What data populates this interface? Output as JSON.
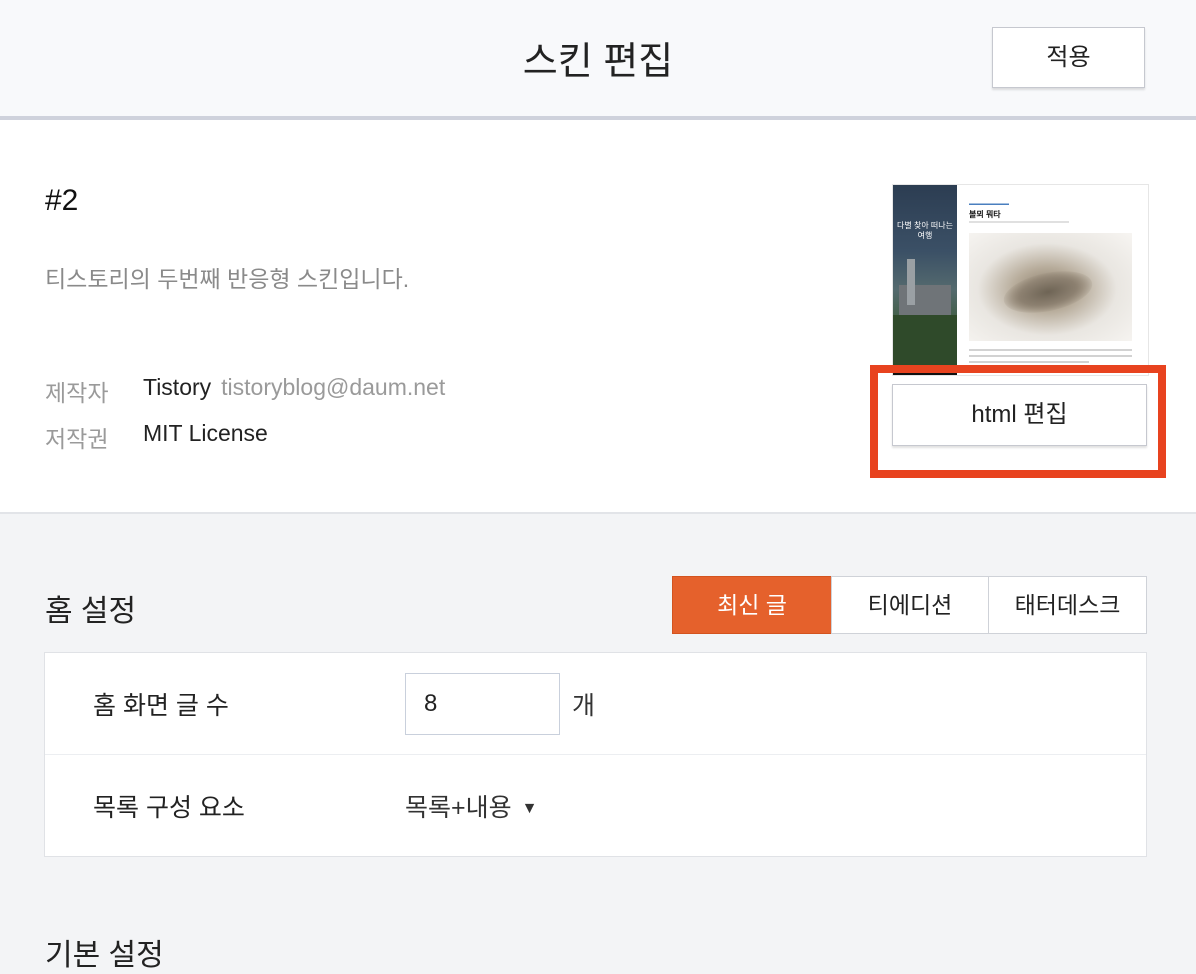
{
  "header": {
    "title": "스킨 편집",
    "apply_label": "적용"
  },
  "skin": {
    "name": "#2",
    "description": "티스토리의 두번째 반응형 스킨입니다.",
    "maker_label": "제작자",
    "maker_name": "Tistory",
    "maker_email": "tistoryblog@daum.net",
    "license_label": "저작권",
    "license_value": "MIT License",
    "html_edit_label": "html 편집",
    "preview": {
      "sidebar_text": "다별 찾아 떠나는 여행",
      "post_title": "볼뫼 뭐타"
    }
  },
  "home_settings": {
    "title": "홈 설정",
    "tabs": [
      {
        "label": "최신 글",
        "active": true
      },
      {
        "label": "티에디션",
        "active": false
      },
      {
        "label": "태터데스크",
        "active": false
      }
    ],
    "post_count_label": "홈 화면 글 수",
    "post_count_value": "8",
    "post_count_unit": "개",
    "list_components_label": "목록 구성 요소",
    "list_components_value": "목록+내용"
  },
  "next_section": {
    "title": "기본 설정"
  },
  "colors": {
    "accent": "#e5612c",
    "highlight": "#e8431f"
  }
}
